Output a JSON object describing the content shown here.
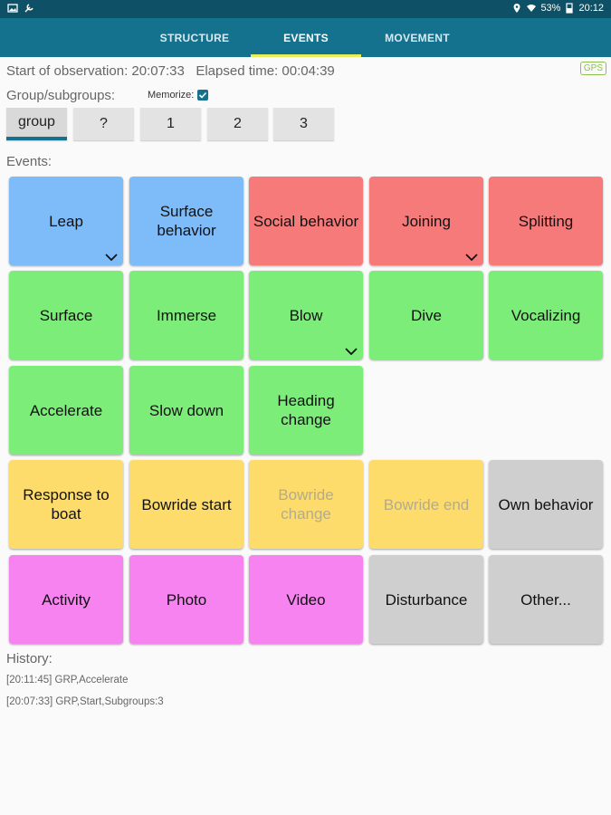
{
  "status_bar": {
    "battery": "53%",
    "time": "20:12"
  },
  "tabs": [
    {
      "label": "STRUCTURE"
    },
    {
      "label": "EVENTS"
    },
    {
      "label": "MOVEMENT"
    }
  ],
  "observation": {
    "start_label": "Start of observation:",
    "start_time": "20:07:33",
    "elapsed_label": "Elapsed time:",
    "elapsed_time": "00:04:39",
    "gps": "GPS"
  },
  "groups": {
    "label": "Group/subgroups:",
    "memorize_label": "Memorize:",
    "buttons": [
      "group",
      "?",
      "1",
      "2",
      "3"
    ]
  },
  "events": {
    "label": "Events:",
    "items": [
      "Leap",
      "Surface behavior",
      "Social behavior",
      "Joining",
      "Splitting",
      "Surface",
      "Immerse",
      "Blow",
      "Dive",
      "Vocalizing",
      "Accelerate",
      "Slow down",
      "Heading change",
      "Response to boat",
      "Bowride start",
      "Bowride change",
      "Bowride end",
      "Own behavior",
      "Activity",
      "Photo",
      "Video",
      "Disturbance",
      "Other..."
    ]
  },
  "history": {
    "label": "History:",
    "entries": [
      "[20:11:45] GRP,Accelerate",
      "[20:07:33] GRP,Start,Subgroups:3"
    ]
  },
  "colors": {
    "primary": "#15728f",
    "status_bar": "#0e5066",
    "blue": "#7dbcf8",
    "red": "#f67a7a",
    "green": "#7ded7a",
    "yellow": "#fedc6c",
    "pink": "#f683ef",
    "gray": "#cfcfcf"
  }
}
